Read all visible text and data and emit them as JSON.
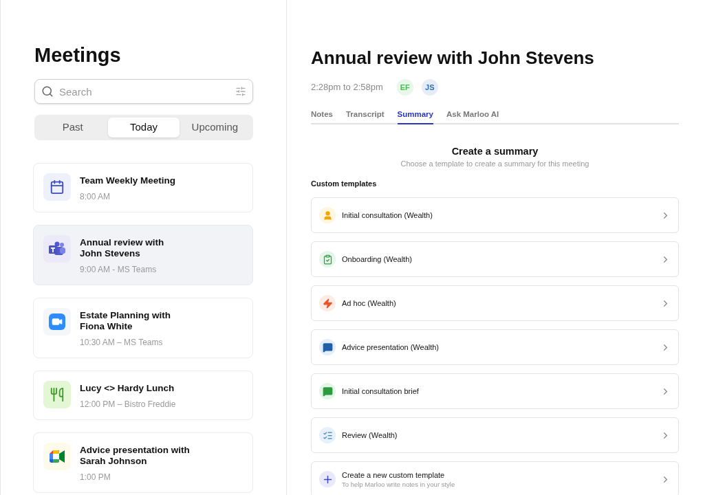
{
  "sidebar": {
    "title": "Meetings",
    "search": {
      "placeholder": "Search"
    },
    "segments": [
      {
        "label": "Past",
        "selected": false
      },
      {
        "label": "Today",
        "selected": true
      },
      {
        "label": "Upcoming",
        "selected": false
      }
    ],
    "meetings": [
      {
        "kind": "calendar",
        "title": "Team Weekly Meeting",
        "subtitle": "8:00 AM",
        "selected": false
      },
      {
        "kind": "teams",
        "title": "Annual review with\nJohn Stevens",
        "subtitle": "9:00 AM - MS Teams",
        "selected": true
      },
      {
        "kind": "zoom",
        "title": "Estate Planning with\nFiona White",
        "subtitle": "10:30 AM – MS Teams",
        "selected": false
      },
      {
        "kind": "lunch",
        "title": "Lucy <> Hardy Lunch",
        "subtitle": "12:00 PM – Bistro Freddie",
        "selected": false
      },
      {
        "kind": "meet",
        "title": "Advice presentation with\nSarah Johnson",
        "subtitle": "1:00 PM",
        "selected": false
      }
    ]
  },
  "detail": {
    "title": "Annual review with John Stevens",
    "time": "2:28pm to 2:58pm",
    "attendees": [
      {
        "initials": "EF",
        "color": "#3fbf4f"
      },
      {
        "initials": "JS",
        "color": "#2f6fbf"
      }
    ],
    "tabs": [
      {
        "label": "Notes",
        "selected": false
      },
      {
        "label": "Transcript",
        "selected": false
      },
      {
        "label": "Summary",
        "selected": true
      },
      {
        "label": "Ask Marloo AI",
        "selected": false
      }
    ],
    "summary": {
      "title": "Create a summary",
      "subtitle": "Choose a template to create a summary for this meeting",
      "section": "Custom templates",
      "templates": [
        {
          "kind": "person",
          "label": "Initial consultation (Wealth)"
        },
        {
          "kind": "clipboard",
          "label": "Onboarding (Wealth)"
        },
        {
          "kind": "bolt",
          "label": "Ad hoc (Wealth)"
        },
        {
          "kind": "chat-blue",
          "label": "Advice presentation (Wealth)"
        },
        {
          "kind": "chat-green",
          "label": "Initial consultation brief"
        },
        {
          "kind": "list",
          "label": "Review (Wealth)"
        },
        {
          "kind": "plus",
          "label": "Create a new custom template",
          "hint": "To help Marloo write notes in your style"
        }
      ]
    }
  }
}
